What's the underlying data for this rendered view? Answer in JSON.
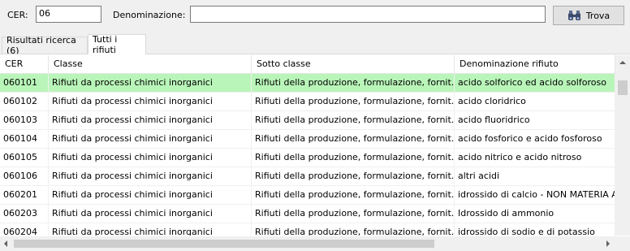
{
  "search": {
    "cer_label": "CER:",
    "cer_value": "06",
    "denominazione_label": "Denominazione:",
    "denominazione_value": "",
    "find_button": "Trova"
  },
  "tabs": [
    {
      "label": "Risultati ricerca (6)",
      "active": false
    },
    {
      "label": "Tutti i rifiuti",
      "active": true
    }
  ],
  "table": {
    "headers": [
      "CER",
      "Classe",
      "Sotto classe",
      "Denominazione rifiuto"
    ],
    "rows": [
      {
        "cer": "060101",
        "classe": "Rifiuti da processi chimici inorganici",
        "sotto": "Rifiuti della produzione, formulazione, fornit...",
        "den": "acido solforico ed acido solforoso",
        "selected": true
      },
      {
        "cer": "060102",
        "classe": "Rifiuti da processi chimici inorganici",
        "sotto": "Rifiuti della produzione, formulazione, fornit...",
        "den": "acido cloridrico"
      },
      {
        "cer": "060103",
        "classe": "Rifiuti da processi chimici inorganici",
        "sotto": "Rifiuti della produzione, formulazione, fornit...",
        "den": "acido fluoridrico"
      },
      {
        "cer": "060104",
        "classe": "Rifiuti da processi chimici inorganici",
        "sotto": "Rifiuti della produzione, formulazione, fornit...",
        "den": "acido fosforico e acido fosforoso"
      },
      {
        "cer": "060105",
        "classe": "Rifiuti da processi chimici inorganici",
        "sotto": "Rifiuti della produzione, formulazione, fornit...",
        "den": "acido nitrico e acido nitroso"
      },
      {
        "cer": "060106",
        "classe": "Rifiuti da processi chimici inorganici",
        "sotto": "Rifiuti della produzione, formulazione, fornit...",
        "den": "altri acidi"
      },
      {
        "cer": "060201",
        "classe": "Rifiuti da processi chimici inorganici",
        "sotto": "Rifiuti della produzione, formulazione, fornit...",
        "den": "idrossido di calcio - NON MATERIA A"
      },
      {
        "cer": "060203",
        "classe": "Rifiuti da processi chimici inorganici",
        "sotto": "Rifiuti della produzione, formulazione, fornit...",
        "den": "Idrossido di ammonio"
      },
      {
        "cer": "060204",
        "classe": "Rifiuti da processi chimici inorganici",
        "sotto": "Rifiuti della produzione, formulazione, fornit...",
        "den": "idrossido di sodio e di potassio"
      }
    ]
  },
  "colors": {
    "selected_row": "#b9f5b9",
    "button_bg": "#e1e1e1"
  },
  "icons": {
    "find": "binoculars-icon"
  }
}
